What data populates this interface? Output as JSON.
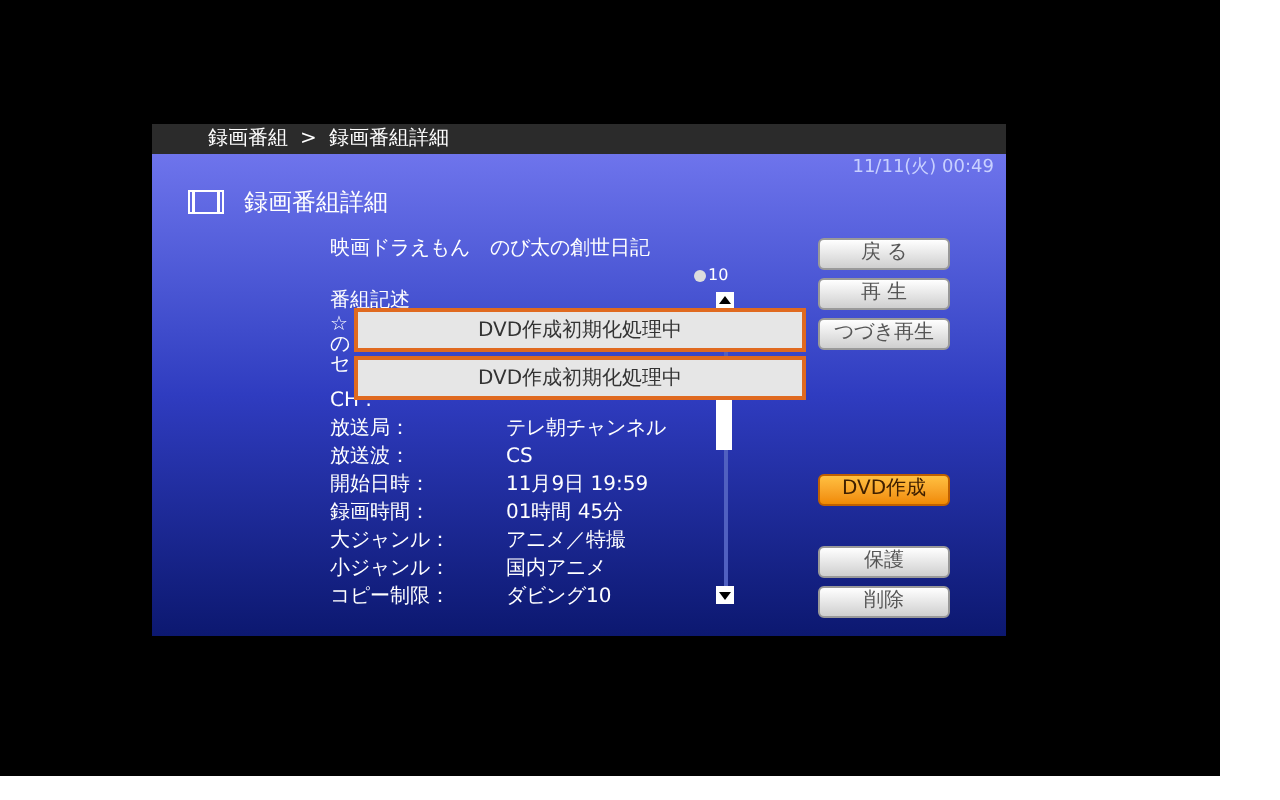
{
  "breadcrumb": {
    "items": [
      "録画番組",
      "録画番組詳細"
    ],
    "separator": ">"
  },
  "datetime": "11/11(火) 00:49",
  "title": "録画番組詳細",
  "program_title": "映画ドラえもん　のび太の創世日記",
  "copy_count": "10",
  "description": {
    "heading": "番組記述",
    "lines": [
      "☆",
      "の",
      "セ"
    ]
  },
  "details": [
    {
      "label": "CH :"
    },
    {
      "label": "放送局：",
      "value": "テレ朝チャンネル"
    },
    {
      "label": "放送波：",
      "value": "CS"
    },
    {
      "label": "開始日時：",
      "value": "11月9日  19:59"
    },
    {
      "label": "録画時間：",
      "value": "01時間 45分"
    },
    {
      "label": "大ジャンル：",
      "value": "アニメ／特撮"
    },
    {
      "label": "小ジャンル：",
      "value": "国内アニメ"
    },
    {
      "label": "コピー制限：",
      "value": "ダビング10"
    }
  ],
  "buttons": [
    {
      "label": "戻 る",
      "selected": false
    },
    {
      "label": "再 生",
      "selected": false
    },
    {
      "label": "つづき再生",
      "selected": false
    },
    {
      "label": "DVD作成",
      "selected": true
    },
    {
      "label": "保護",
      "selected": false
    },
    {
      "label": "削除",
      "selected": false
    }
  ],
  "dialogs": [
    "DVD作成初期化処理中",
    "DVD作成初期化処理中"
  ]
}
